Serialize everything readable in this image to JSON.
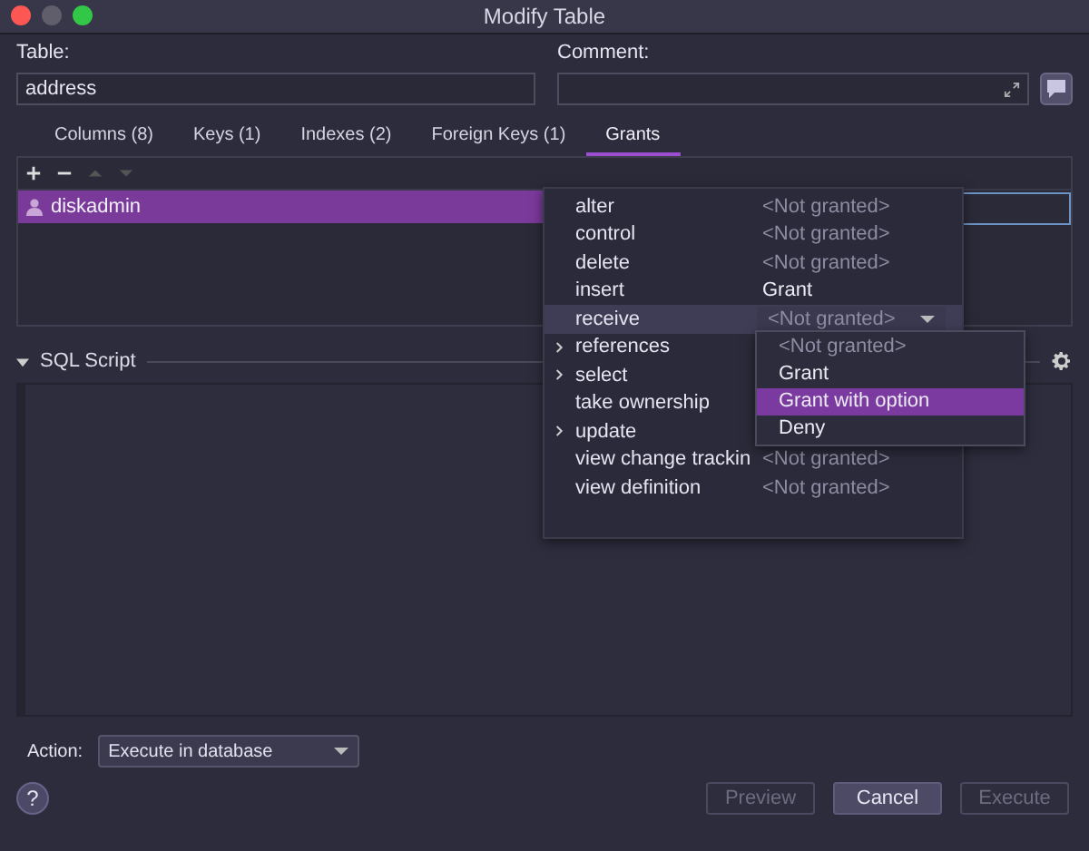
{
  "window": {
    "title": "Modify Table"
  },
  "table_field": {
    "label": "Table:",
    "value": "address"
  },
  "comment_field": {
    "label": "Comment:"
  },
  "tabs": [
    {
      "label": "Columns (8)",
      "selected": false
    },
    {
      "label": "Keys (1)",
      "selected": false
    },
    {
      "label": "Indexes (2)",
      "selected": false
    },
    {
      "label": "Foreign Keys (1)",
      "selected": false
    },
    {
      "label": "Grants",
      "selected": true
    }
  ],
  "toolbar": [
    {
      "kind": "add",
      "disabled": false
    },
    {
      "kind": "remove",
      "disabled": false
    },
    {
      "kind": "up",
      "disabled": true
    },
    {
      "kind": "down",
      "disabled": true
    }
  ],
  "users": [
    {
      "name": "diskadmin",
      "selected": true
    }
  ],
  "privileges": [
    {
      "name": "alter",
      "value": "<Not granted>",
      "granted": false,
      "expandable": false,
      "selected": false
    },
    {
      "name": "control",
      "value": "<Not granted>",
      "granted": false,
      "expandable": false,
      "selected": false
    },
    {
      "name": "delete",
      "value": "<Not granted>",
      "granted": false,
      "expandable": false,
      "selected": false
    },
    {
      "name": "insert",
      "value": "Grant",
      "granted": true,
      "expandable": false,
      "selected": false
    },
    {
      "name": "receive",
      "value": "<Not granted>",
      "granted": false,
      "expandable": false,
      "selected": true
    },
    {
      "name": "references",
      "expandable": true,
      "selected": false
    },
    {
      "name": "select",
      "expandable": true,
      "selected": false
    },
    {
      "name": "take ownership",
      "expandable": false,
      "selected": false
    },
    {
      "name": "update",
      "expandable": true,
      "selected": false
    },
    {
      "name": "view change trackin",
      "value": "<Not granted>",
      "granted": false,
      "expandable": false,
      "selected": false
    },
    {
      "name": "view definition",
      "value": "<Not granted>",
      "granted": false,
      "expandable": false,
      "selected": false
    }
  ],
  "dropdown_options": [
    {
      "label": "<Not granted>",
      "selected": false,
      "disabled": true
    },
    {
      "label": "Grant",
      "selected": false,
      "disabled": false
    },
    {
      "label": "Grant with option",
      "selected": true,
      "disabled": false
    },
    {
      "label": "Deny",
      "selected": false,
      "disabled": false
    }
  ],
  "sql_section": {
    "title": "SQL Script",
    "expanded": true
  },
  "action": {
    "label": "Action:",
    "value": "Execute in database"
  },
  "help_button": "?",
  "buttons": [
    {
      "label": "Preview",
      "disabled": true,
      "default": false
    },
    {
      "label": "Cancel",
      "disabled": false,
      "default": true
    },
    {
      "label": "Execute",
      "disabled": true,
      "default": false
    }
  ]
}
